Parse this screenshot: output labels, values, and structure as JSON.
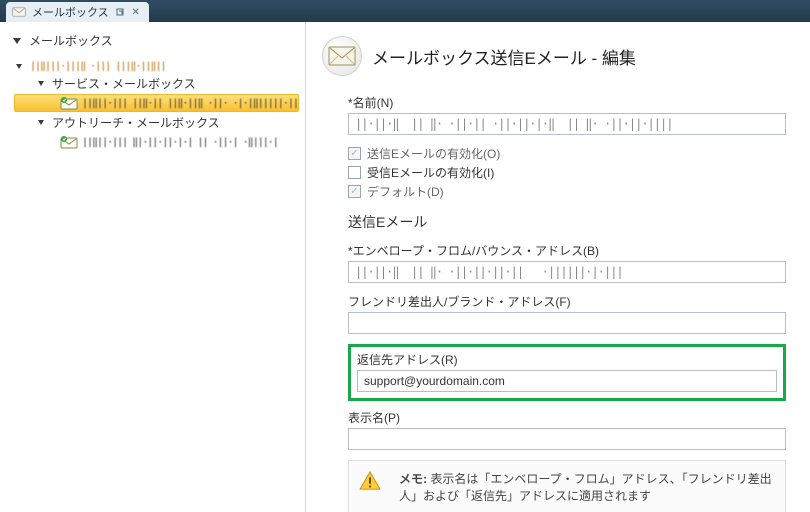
{
  "tab": {
    "title": "メールボックス"
  },
  "sidebar": {
    "header": "メールボックス",
    "root_barcode": "||‖|||·|||‖ ·||| |||‖·||‖||",
    "groups": [
      {
        "label": "サービス・メールボックス",
        "items": [
          {
            "barcode": "||‖||·||| ||‖·|| ||‖·||‖ ·||· ·|·|‖|||||·||",
            "selected": true
          }
        ]
      },
      {
        "label": "アウトリーチ・メールボックス",
        "items": [
          {
            "barcode": "||‖||·|||  ‖|·||·||·|·|  ||  ·||·|  ·‖|||·|",
            "selected": false
          }
        ]
      }
    ]
  },
  "page": {
    "title": "メールボックス送信Eメール - 編集"
  },
  "form": {
    "name_label": "*名前(N)",
    "name_value": "||·||·‖  || ‖· ·||·|| ·||·||·|·‖  || ‖· ·||·||·||||",
    "check1": "送信Eメールの有効化(O)",
    "check2": "受信Eメールの有効化(I)",
    "check3": "デフォルト(D)",
    "section_title": "送信Eメール",
    "envelope_label": "*エンベロープ・フロム/バウンス・アドレス(B)",
    "envelope_value": "||·||·‖  || ‖· ·||·||·||·||   ·||||||·|·|||",
    "friendly_label": "フレンドリ差出人/ブランド・アドレス(F)",
    "friendly_value": "",
    "reply_label": "返信先アドレス(R)",
    "reply_value": "support@yourdomain.com",
    "display_label": "表示名(P)",
    "display_value": "",
    "note_label": "メモ:",
    "note_text": "表示名は「エンベロープ・フロム」アドレス、「フレンドリ差出人」および「返信先」アドレスに適用されます"
  }
}
